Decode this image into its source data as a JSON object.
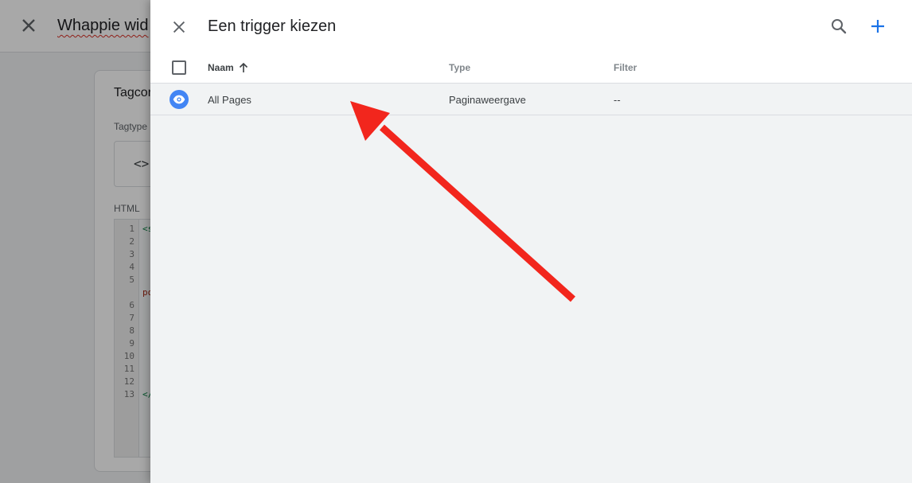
{
  "background_editor": {
    "title": "Whappie wid",
    "card_title": "Tagcor",
    "tagtype_label": "Tagtype",
    "tagtype_icon": "<>",
    "html_label": "HTML",
    "line_numbers": [
      "1",
      "2",
      "3",
      "4",
      "5",
      "6",
      "7",
      "8",
      "9",
      "10",
      "11",
      "12",
      "13"
    ],
    "code_fragments": {
      "line1": "<s",
      "line5_wrap": "po",
      "line13": "</"
    }
  },
  "trigger_panel": {
    "title": "Een trigger kiezen",
    "icons": {
      "close": "close-icon",
      "search": "search-icon",
      "add": "add-icon",
      "sort": "arrow-up-icon",
      "trigger": "eye-icon"
    },
    "columns": {
      "name": "Naam",
      "type": "Type",
      "filter": "Filter"
    },
    "rows": [
      {
        "name": "All Pages",
        "type": "Paginaweergave",
        "filter": "--"
      }
    ]
  },
  "colors": {
    "accent": "#1a73e8",
    "trigger_icon": "#4285f4",
    "annotation_arrow": "#f2261d"
  }
}
